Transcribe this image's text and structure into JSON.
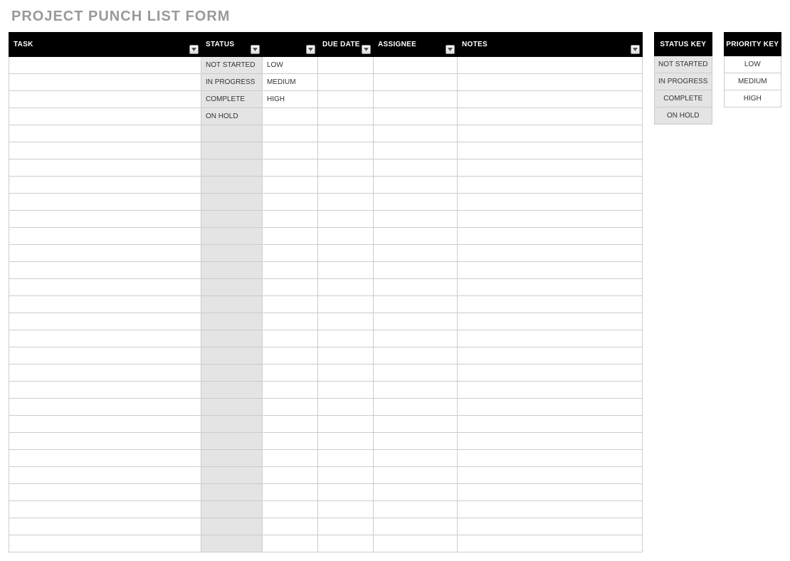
{
  "title": "PROJECT PUNCH LIST FORM",
  "table": {
    "headers": {
      "task": "TASK",
      "status": "STATUS",
      "priority": "",
      "due_date": "DUE DATE",
      "assignee": "ASSIGNEE",
      "notes": "NOTES"
    },
    "rows": [
      {
        "task": "",
        "status": "NOT STARTED",
        "priority": "LOW",
        "due_date": "",
        "assignee": "",
        "notes": ""
      },
      {
        "task": "",
        "status": "IN PROGRESS",
        "priority": "MEDIUM",
        "due_date": "",
        "assignee": "",
        "notes": ""
      },
      {
        "task": "",
        "status": "COMPLETE",
        "priority": "HIGH",
        "due_date": "",
        "assignee": "",
        "notes": ""
      },
      {
        "task": "",
        "status": "ON HOLD",
        "priority": "",
        "due_date": "",
        "assignee": "",
        "notes": ""
      },
      {
        "task": "",
        "status": "",
        "priority": "",
        "due_date": "",
        "assignee": "",
        "notes": ""
      },
      {
        "task": "",
        "status": "",
        "priority": "",
        "due_date": "",
        "assignee": "",
        "notes": ""
      },
      {
        "task": "",
        "status": "",
        "priority": "",
        "due_date": "",
        "assignee": "",
        "notes": ""
      },
      {
        "task": "",
        "status": "",
        "priority": "",
        "due_date": "",
        "assignee": "",
        "notes": ""
      },
      {
        "task": "",
        "status": "",
        "priority": "",
        "due_date": "",
        "assignee": "",
        "notes": ""
      },
      {
        "task": "",
        "status": "",
        "priority": "",
        "due_date": "",
        "assignee": "",
        "notes": ""
      },
      {
        "task": "",
        "status": "",
        "priority": "",
        "due_date": "",
        "assignee": "",
        "notes": ""
      },
      {
        "task": "",
        "status": "",
        "priority": "",
        "due_date": "",
        "assignee": "",
        "notes": ""
      },
      {
        "task": "",
        "status": "",
        "priority": "",
        "due_date": "",
        "assignee": "",
        "notes": ""
      },
      {
        "task": "",
        "status": "",
        "priority": "",
        "due_date": "",
        "assignee": "",
        "notes": ""
      },
      {
        "task": "",
        "status": "",
        "priority": "",
        "due_date": "",
        "assignee": "",
        "notes": ""
      },
      {
        "task": "",
        "status": "",
        "priority": "",
        "due_date": "",
        "assignee": "",
        "notes": ""
      },
      {
        "task": "",
        "status": "",
        "priority": "",
        "due_date": "",
        "assignee": "",
        "notes": ""
      },
      {
        "task": "",
        "status": "",
        "priority": "",
        "due_date": "",
        "assignee": "",
        "notes": ""
      },
      {
        "task": "",
        "status": "",
        "priority": "",
        "due_date": "",
        "assignee": "",
        "notes": ""
      },
      {
        "task": "",
        "status": "",
        "priority": "",
        "due_date": "",
        "assignee": "",
        "notes": ""
      },
      {
        "task": "",
        "status": "",
        "priority": "",
        "due_date": "",
        "assignee": "",
        "notes": ""
      },
      {
        "task": "",
        "status": "",
        "priority": "",
        "due_date": "",
        "assignee": "",
        "notes": ""
      },
      {
        "task": "",
        "status": "",
        "priority": "",
        "due_date": "",
        "assignee": "",
        "notes": ""
      },
      {
        "task": "",
        "status": "",
        "priority": "",
        "due_date": "",
        "assignee": "",
        "notes": ""
      },
      {
        "task": "",
        "status": "",
        "priority": "",
        "due_date": "",
        "assignee": "",
        "notes": ""
      },
      {
        "task": "",
        "status": "",
        "priority": "",
        "due_date": "",
        "assignee": "",
        "notes": ""
      },
      {
        "task": "",
        "status": "",
        "priority": "",
        "due_date": "",
        "assignee": "",
        "notes": ""
      },
      {
        "task": "",
        "status": "",
        "priority": "",
        "due_date": "",
        "assignee": "",
        "notes": ""
      },
      {
        "task": "",
        "status": "",
        "priority": "",
        "due_date": "",
        "assignee": "",
        "notes": ""
      }
    ]
  },
  "status_key": {
    "header": "STATUS KEY",
    "items": [
      "NOT STARTED",
      "IN PROGRESS",
      "COMPLETE",
      "ON HOLD"
    ]
  },
  "priority_key": {
    "header": "PRIORITY KEY",
    "items": [
      "LOW",
      "MEDIUM",
      "HIGH"
    ]
  }
}
